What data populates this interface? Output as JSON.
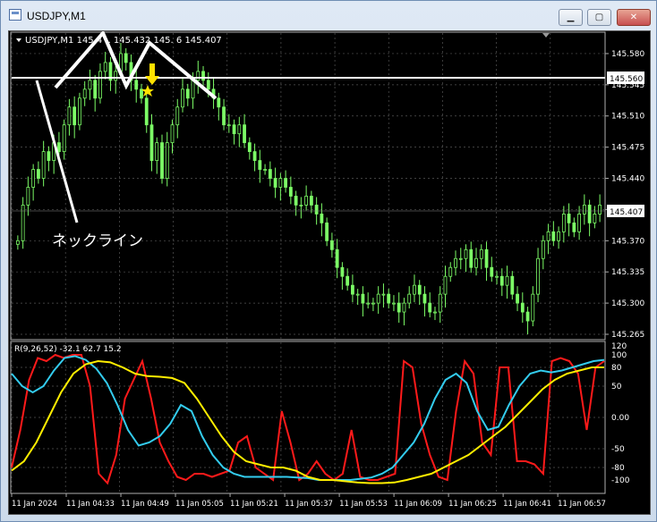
{
  "window": {
    "title": "USDJPY,M1",
    "buttons": {
      "minimize": "▁",
      "maximize": "▢",
      "close": "✕"
    }
  },
  "chart_data": [
    {
      "type": "candlestick",
      "header": "USDJPY,M1  145.4 .. 145.432 145. 6 145.407",
      "symbol": "USDJPY",
      "timeframe": "M1",
      "ylim": [
        145.265,
        145.598
      ],
      "y_ticks": [
        "145.580",
        "145.545",
        "145.510",
        "145.475",
        "145.440",
        "145.405",
        "145.370",
        "145.335",
        "145.300",
        "145.265"
      ],
      "current_price_label": "145.407",
      "current_price": 145.407,
      "horizontal_line_label": "145.560",
      "horizontal_line_value": 145.56,
      "annotation_text": "ネックライン",
      "colors": {
        "bull": "#7cfc66",
        "bear": "#7cfc66",
        "line": "#ffffff",
        "arrow": "#ffe100"
      },
      "candles_close": [
        145.37,
        145.41,
        145.43,
        145.45,
        145.44,
        145.47,
        145.46,
        145.48,
        145.47,
        145.5,
        145.52,
        145.5,
        145.53,
        145.54,
        145.55,
        145.53,
        145.56,
        145.57,
        145.55,
        145.56,
        145.58,
        145.57,
        145.55,
        145.54,
        145.53,
        145.5,
        145.46,
        145.48,
        145.44,
        145.48,
        145.5,
        145.52,
        145.54,
        145.53,
        145.55,
        145.56,
        145.55,
        145.54,
        145.53,
        145.52,
        145.5,
        145.5,
        145.49,
        145.5,
        145.48,
        145.47,
        145.46,
        145.45,
        145.45,
        145.44,
        145.43,
        145.44,
        145.43,
        145.42,
        145.41,
        145.41,
        145.42,
        145.41,
        145.4,
        145.39,
        145.37,
        145.36,
        145.34,
        145.33,
        145.32,
        145.31,
        145.31,
        145.3,
        145.3,
        145.3,
        145.31,
        145.31,
        145.3,
        145.3,
        145.29,
        145.3,
        145.31,
        145.32,
        145.31,
        145.3,
        145.29,
        145.29,
        145.31,
        145.33,
        145.34,
        145.35,
        145.35,
        145.36,
        145.34,
        145.35,
        145.36,
        145.34,
        145.33,
        145.33,
        145.32,
        145.33,
        145.31,
        145.3,
        145.29,
        145.28,
        145.31,
        145.35,
        145.37,
        145.38,
        145.37,
        145.38,
        145.4,
        145.39,
        145.38,
        145.4,
        145.41,
        145.39,
        145.4,
        145.41
      ]
    },
    {
      "type": "line",
      "indicator_label": "R(9,26,52) -32.1 62.7 15.2",
      "ylim": [
        -120,
        120
      ],
      "y_ticks": [
        "120",
        "100",
        "80",
        "50",
        "0.00",
        "-50",
        "-80",
        "-100"
      ],
      "x_tick_labels": [
        "11 Jan 2024",
        "11 Jan 04:33",
        "11 Jan 04:49",
        "11 Jan 05:05",
        "11 Jan 05:21",
        "11 Jan 05:37",
        "11 Jan 05:53",
        "11 Jan 06:09",
        "11 Jan 06:25",
        "11 Jan 06:41",
        "11 Jan 06:57"
      ],
      "series": [
        {
          "color": "#ff1a1a",
          "values": [
            -80,
            -20,
            60,
            95,
            90,
            100,
            95,
            100,
            100,
            50,
            -90,
            -105,
            -60,
            30,
            60,
            90,
            30,
            -40,
            -70,
            -95,
            -100,
            -90,
            -90,
            -95,
            -90,
            -85,
            -40,
            -30,
            -80,
            -90,
            -100,
            10,
            -40,
            -100,
            -90,
            -70,
            -90,
            -100,
            -90,
            -20,
            -95,
            -100,
            -100,
            -95,
            -90,
            90,
            80,
            -10,
            -60,
            -95,
            -100,
            10,
            90,
            70,
            -40,
            -60,
            80,
            80,
            -70,
            -70,
            -75,
            -90,
            90,
            95,
            90,
            70,
            -20,
            80,
            90
          ]
        },
        {
          "color": "#33ccee",
          "values": [
            70,
            50,
            40,
            50,
            75,
            95,
            98,
            92,
            78,
            55,
            20,
            -20,
            -45,
            -40,
            -30,
            -10,
            20,
            10,
            -30,
            -60,
            -80,
            -90,
            -95,
            -95,
            -95,
            -95,
            -95,
            -96,
            -97,
            -100,
            -100,
            -100,
            -100,
            -98,
            -96,
            -90,
            -80,
            -60,
            -40,
            -10,
            30,
            60,
            70,
            55,
            10,
            -20,
            -15,
            20,
            50,
            70,
            75,
            72,
            75,
            80,
            85,
            90,
            92
          ]
        },
        {
          "color": "#ffee00",
          "values": [
            -85,
            -70,
            -40,
            0,
            40,
            70,
            85,
            90,
            88,
            80,
            70,
            66,
            65,
            63,
            55,
            30,
            0,
            -30,
            -55,
            -70,
            -75,
            -80,
            -80,
            -85,
            -95,
            -100,
            -100,
            -102,
            -104,
            -105,
            -105,
            -104,
            -100,
            -95,
            -90,
            -80,
            -70,
            -60,
            -45,
            -30,
            -15,
            5,
            25,
            45,
            60,
            70,
            75,
            80,
            80
          ]
        }
      ]
    }
  ]
}
